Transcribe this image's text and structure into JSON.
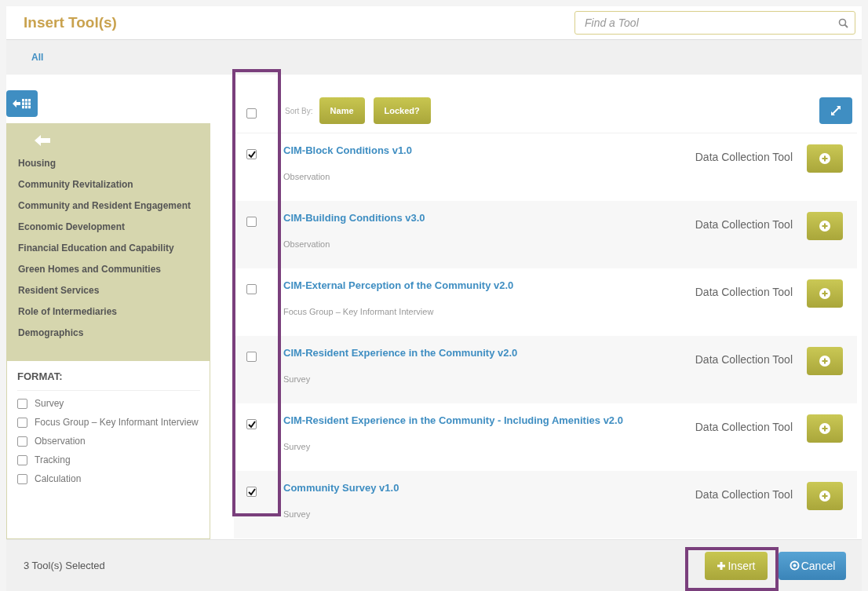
{
  "title": "Insert Tool(s)",
  "search": {
    "placeholder": "Find a Tool"
  },
  "tabs": [
    {
      "label": "All",
      "selected": true
    }
  ],
  "sidebar": {
    "categories": [
      "Housing",
      "Community Revitalization",
      "Community and Resident Engagement",
      "Economic Development",
      "Financial Education and Capability",
      "Green Homes and Communities",
      "Resident Services",
      "Role of Intermediaries",
      "Demographics"
    ],
    "format_heading": "FORMAT:",
    "formats": [
      {
        "label": "Survey",
        "checked": false
      },
      {
        "label": "Focus Group – Key Informant Interview",
        "checked": false
      },
      {
        "label": "Observation",
        "checked": false
      },
      {
        "label": "Tracking",
        "checked": false
      },
      {
        "label": "Calculation",
        "checked": false
      }
    ]
  },
  "sort": {
    "select_all": false,
    "label": "Sort By:",
    "buttons": [
      "Name",
      "Locked?"
    ]
  },
  "tools": [
    {
      "name": "CIM-Block Conditions v1.0",
      "format": "Observation",
      "type": "Data Collection Tool",
      "checked": true
    },
    {
      "name": "CIM-Building Conditions v3.0",
      "format": "Observation",
      "type": "Data Collection Tool",
      "checked": false
    },
    {
      "name": "CIM-External Perception of the Community v2.0",
      "format": "Focus Group – Key Informant Interview",
      "type": "Data Collection Tool",
      "checked": false
    },
    {
      "name": "CIM-Resident Experience in the Community v2.0",
      "format": "Survey",
      "type": "Data Collection Tool",
      "checked": false
    },
    {
      "name": "CIM-Resident Experience in the Community - Including Amenities v2.0",
      "format": "Survey",
      "type": "Data Collection Tool",
      "checked": true
    },
    {
      "name": "Community Survey v1.0",
      "format": "Survey",
      "type": "Data Collection Tool",
      "checked": true
    }
  ],
  "footer": {
    "status": "3 Tool(s) Selected",
    "insert": "Insert",
    "cancel": "Cancel"
  }
}
